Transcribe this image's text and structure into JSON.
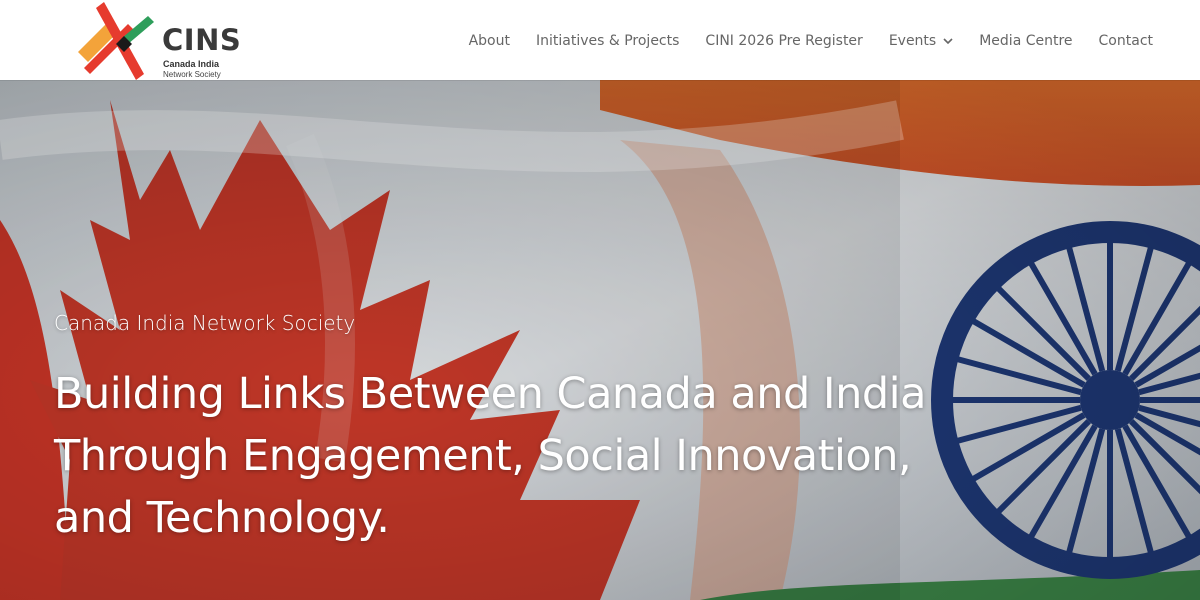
{
  "header": {
    "logo": {
      "name": "CINS",
      "subtitle_line1": "Canada India",
      "subtitle_line2": "Network Society",
      "colors": [
        "#e63b2e",
        "#f3a33a",
        "#2e9e5b",
        "#1a1a1a"
      ]
    },
    "nav": [
      {
        "label": "About"
      },
      {
        "label": "Initiatives & Projects"
      },
      {
        "label": "CINI 2026 Pre Register"
      },
      {
        "label": "Events",
        "has_dropdown": true
      },
      {
        "label": "Media Centre"
      },
      {
        "label": "Contact"
      }
    ]
  },
  "hero": {
    "tagline": "Canada India Network Society",
    "headline": "Building Links Between Canada and India Through Engagement, Social Innovation, and Technology.",
    "colors": {
      "canada_red": "#d6392a",
      "india_saffron": "#e8722e",
      "india_green": "#3e8a4a",
      "chakra_navy": "#1f3a7a"
    }
  }
}
